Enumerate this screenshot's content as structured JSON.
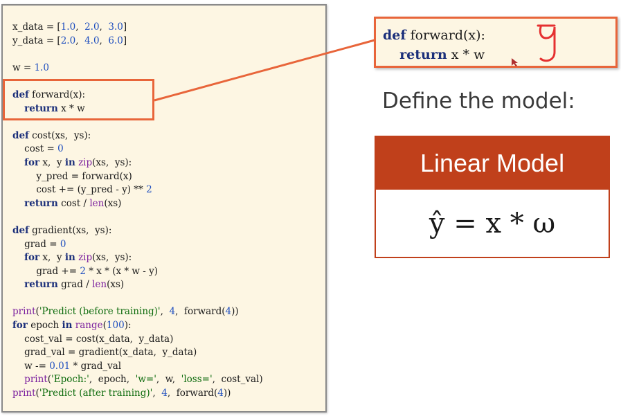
{
  "code_panel": {
    "lines": [
      [
        {
          "t": "x_data = ["
        },
        {
          "t": "1.0",
          "c": "num"
        },
        {
          "t": ",  "
        },
        {
          "t": "2.0",
          "c": "num"
        },
        {
          "t": ",  "
        },
        {
          "t": "3.0",
          "c": "num"
        },
        {
          "t": "]"
        }
      ],
      [
        {
          "t": "y_data = ["
        },
        {
          "t": "2.0",
          "c": "num"
        },
        {
          "t": ",  "
        },
        {
          "t": "4.0",
          "c": "num"
        },
        {
          "t": ",  "
        },
        {
          "t": "6.0",
          "c": "num"
        },
        {
          "t": "]"
        }
      ],
      [],
      [
        {
          "t": "w = "
        },
        {
          "t": "1.0",
          "c": "num"
        }
      ],
      [],
      [
        {
          "t": "def",
          "c": "kw"
        },
        {
          "t": " forward(x):"
        }
      ],
      [
        {
          "t": "    "
        },
        {
          "t": "return",
          "c": "kw"
        },
        {
          "t": " x * w"
        }
      ],
      [],
      [
        {
          "t": "def",
          "c": "kw"
        },
        {
          "t": " cost(xs,  ys):"
        }
      ],
      [
        {
          "t": "    cost = "
        },
        {
          "t": "0",
          "c": "num"
        }
      ],
      [
        {
          "t": "    "
        },
        {
          "t": "for",
          "c": "kw"
        },
        {
          "t": " x,  y "
        },
        {
          "t": "in",
          "c": "kw"
        },
        {
          "t": " "
        },
        {
          "t": "zip",
          "c": "bi"
        },
        {
          "t": "(xs,  ys):"
        }
      ],
      [
        {
          "t": "        y_pred = forward(x)"
        }
      ],
      [
        {
          "t": "        cost += (y_pred - y) ** "
        },
        {
          "t": "2",
          "c": "num"
        }
      ],
      [
        {
          "t": "    "
        },
        {
          "t": "return",
          "c": "kw"
        },
        {
          "t": " cost / "
        },
        {
          "t": "len",
          "c": "bi"
        },
        {
          "t": "(xs)"
        }
      ],
      [],
      [
        {
          "t": "def",
          "c": "kw"
        },
        {
          "t": " gradient(xs,  ys):"
        }
      ],
      [
        {
          "t": "    grad = "
        },
        {
          "t": "0",
          "c": "num"
        }
      ],
      [
        {
          "t": "    "
        },
        {
          "t": "for",
          "c": "kw"
        },
        {
          "t": " x,  y "
        },
        {
          "t": "in",
          "c": "kw"
        },
        {
          "t": " "
        },
        {
          "t": "zip",
          "c": "bi"
        },
        {
          "t": "(xs,  ys):"
        }
      ],
      [
        {
          "t": "        grad += "
        },
        {
          "t": "2",
          "c": "num"
        },
        {
          "t": " * x * (x * w - y)"
        }
      ],
      [
        {
          "t": "    "
        },
        {
          "t": "return",
          "c": "kw"
        },
        {
          "t": " grad / "
        },
        {
          "t": "len",
          "c": "bi"
        },
        {
          "t": "(xs)"
        }
      ],
      [],
      [
        {
          "t": "print",
          "c": "bi"
        },
        {
          "t": "("
        },
        {
          "t": "'Predict (before training)'",
          "c": "str"
        },
        {
          "t": ",  "
        },
        {
          "t": "4",
          "c": "num"
        },
        {
          "t": ",  forward("
        },
        {
          "t": "4",
          "c": "num"
        },
        {
          "t": "))"
        }
      ],
      [
        {
          "t": "for",
          "c": "kw"
        },
        {
          "t": " epoch "
        },
        {
          "t": "in",
          "c": "kw"
        },
        {
          "t": " "
        },
        {
          "t": "range",
          "c": "bi"
        },
        {
          "t": "("
        },
        {
          "t": "100",
          "c": "num"
        },
        {
          "t": "):"
        }
      ],
      [
        {
          "t": "    cost_val = cost(x_data,  y_data)"
        }
      ],
      [
        {
          "t": "    grad_val = gradient(x_data,  y_data)"
        }
      ],
      [
        {
          "t": "    w -= "
        },
        {
          "t": "0.01",
          "c": "num"
        },
        {
          "t": " * grad_val"
        }
      ],
      [
        {
          "t": "    "
        },
        {
          "t": "print",
          "c": "bi"
        },
        {
          "t": "("
        },
        {
          "t": "'Epoch:'",
          "c": "str"
        },
        {
          "t": ",  epoch,  "
        },
        {
          "t": "'w='",
          "c": "str"
        },
        {
          "t": ",  w,  "
        },
        {
          "t": "'loss='",
          "c": "str"
        },
        {
          "t": ",  cost_val)"
        }
      ],
      [
        {
          "t": "print",
          "c": "bi"
        },
        {
          "t": "("
        },
        {
          "t": "'Predict (after training)'",
          "c": "str"
        },
        {
          "t": ",  "
        },
        {
          "t": "4",
          "c": "num"
        },
        {
          "t": ",  forward("
        },
        {
          "t": "4",
          "c": "num"
        },
        {
          "t": "))"
        }
      ]
    ]
  },
  "callout": {
    "lines": [
      [
        {
          "t": "def",
          "c": "kw"
        },
        {
          "t": " forward(x):"
        }
      ],
      [
        {
          "t": "    "
        },
        {
          "t": "return",
          "c": "kw"
        },
        {
          "t": " x * w"
        }
      ]
    ]
  },
  "heading": "Define the model:",
  "model_card": {
    "title": "Linear Model",
    "formula": "ŷ = x * ω"
  },
  "colors": {
    "highlight": "#e8653a",
    "card": "#c0401b",
    "panel_bg": "#fdf6e3"
  }
}
